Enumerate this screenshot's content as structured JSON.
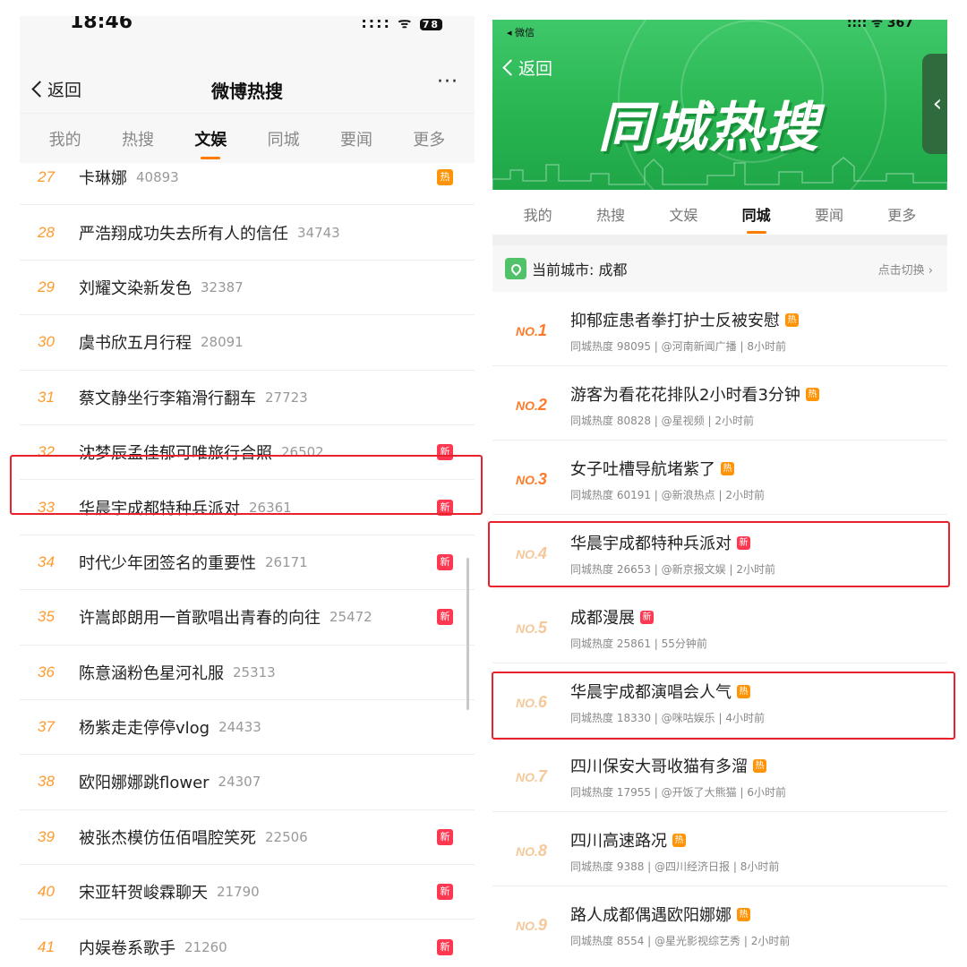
{
  "left": {
    "status": {
      "time": "18:46",
      "signal": "::::",
      "battery": "78"
    },
    "back_label": "返回",
    "title": "微博热搜",
    "more": "···",
    "tabs": [
      {
        "label": "我的"
      },
      {
        "label": "热搜"
      },
      {
        "label": "文娱",
        "active": true
      },
      {
        "label": "同城"
      },
      {
        "label": "要闻"
      },
      {
        "label": "更多"
      }
    ],
    "items": [
      {
        "rank": "27",
        "word": "卡琳娜",
        "heat": "40893",
        "badge": "热"
      },
      {
        "rank": "28",
        "word": "严浩翔成功失去所有人的信任",
        "heat": "34743",
        "badge": ""
      },
      {
        "rank": "29",
        "word": "刘耀文染新发色",
        "heat": "32387",
        "badge": ""
      },
      {
        "rank": "30",
        "word": "虞书欣五月行程",
        "heat": "28091",
        "badge": ""
      },
      {
        "rank": "31",
        "word": "蔡文静坐行李箱滑行翻车",
        "heat": "27723",
        "badge": ""
      },
      {
        "rank": "32",
        "word": "沈梦辰孟佳郁可唯旅行合照",
        "heat": "26502",
        "badge": "新"
      },
      {
        "rank": "33",
        "word": "华晨宇成都特种兵派对",
        "heat": "26361",
        "badge": "新"
      },
      {
        "rank": "34",
        "word": "时代少年团签名的重要性",
        "heat": "26171",
        "badge": "新"
      },
      {
        "rank": "35",
        "word": "许嵩郎朗用一首歌唱出青春的向往",
        "heat": "25472",
        "badge": "新"
      },
      {
        "rank": "36",
        "word": "陈意涵粉色星河礼服",
        "heat": "25313",
        "badge": ""
      },
      {
        "rank": "37",
        "word": "杨紫走走停停vlog",
        "heat": "24433",
        "badge": ""
      },
      {
        "rank": "38",
        "word": "欧阳娜娜跳flower",
        "heat": "24307",
        "badge": ""
      },
      {
        "rank": "39",
        "word": "被张杰模仿伍佰唱腔笑死",
        "heat": "22506",
        "badge": "新"
      },
      {
        "rank": "40",
        "word": "宋亚轩贺峻霖聊天",
        "heat": "21790",
        "badge": "新"
      },
      {
        "rank": "41",
        "word": "内娱卷系歌手",
        "heat": "21260",
        "badge": "新"
      }
    ]
  },
  "right": {
    "status": {
      "carrier": "◂ 微信",
      "signal": "::::  ᯤ 367"
    },
    "back_label": "返回",
    "more": "·",
    "banner_title": "同城热搜",
    "side_handle": "‹",
    "tabs": [
      {
        "label": "我的"
      },
      {
        "label": "热搜"
      },
      {
        "label": "文娱"
      },
      {
        "label": "同城",
        "active": true
      },
      {
        "label": "要闻"
      },
      {
        "label": "更多"
      }
    ],
    "city_label": "当前城市: 成都",
    "switch_label": "点击切换 ›",
    "items": [
      {
        "no": "NO.",
        "n": "1",
        "title": "抑郁症患者拳打护士反被安慰",
        "badge": "热",
        "meta": "同城热度 98095 | @河南新闻广播 | 8小时前"
      },
      {
        "no": "NO.",
        "n": "2",
        "title": "游客为看花花排队2小时看3分钟",
        "badge": "热",
        "meta": "同城热度 80828 | @星视频 | 2小时前"
      },
      {
        "no": "NO.",
        "n": "3",
        "title": "女子吐槽导航堵紫了",
        "badge": "热",
        "meta": "同城热度 60191 | @新浪热点 | 2小时前"
      },
      {
        "no": "NO.",
        "n": "4",
        "title": "华晨宇成都特种兵派对",
        "badge": "新",
        "meta": "同城热度 26653 | @新京报文娱 | 2小时前"
      },
      {
        "no": "NO.",
        "n": "5",
        "title": "成都漫展",
        "badge": "新",
        "meta": "同城热度 25861 | 55分钟前"
      },
      {
        "no": "NO.",
        "n": "6",
        "title": "华晨宇成都演唱会人气",
        "badge": "热",
        "meta": "同城热度 18330 | @咪咕娱乐 | 4小时前"
      },
      {
        "no": "NO.",
        "n": "7",
        "title": "四川保安大哥收猫有多溜",
        "badge": "热",
        "meta": "同城热度 17955 | @开饭了大熊猫 | 6小时前"
      },
      {
        "no": "NO.",
        "n": "8",
        "title": "四川高速路况",
        "badge": "热",
        "meta": "同城热度 9388 | @四川经济日报 | 8小时前"
      },
      {
        "no": "NO.",
        "n": "9",
        "title": "路人成都偶遇欧阳娜娜",
        "badge": "热",
        "meta": "同城热度 8554 | @星光影视综艺秀 | 2小时前"
      }
    ]
  },
  "colors": {
    "rank_orange": "#ff9a2e",
    "hot_badge": "#ff9406",
    "new_badge": "#ff3852",
    "banner_green": "#2db755",
    "highlight_red": "#e8212a"
  }
}
